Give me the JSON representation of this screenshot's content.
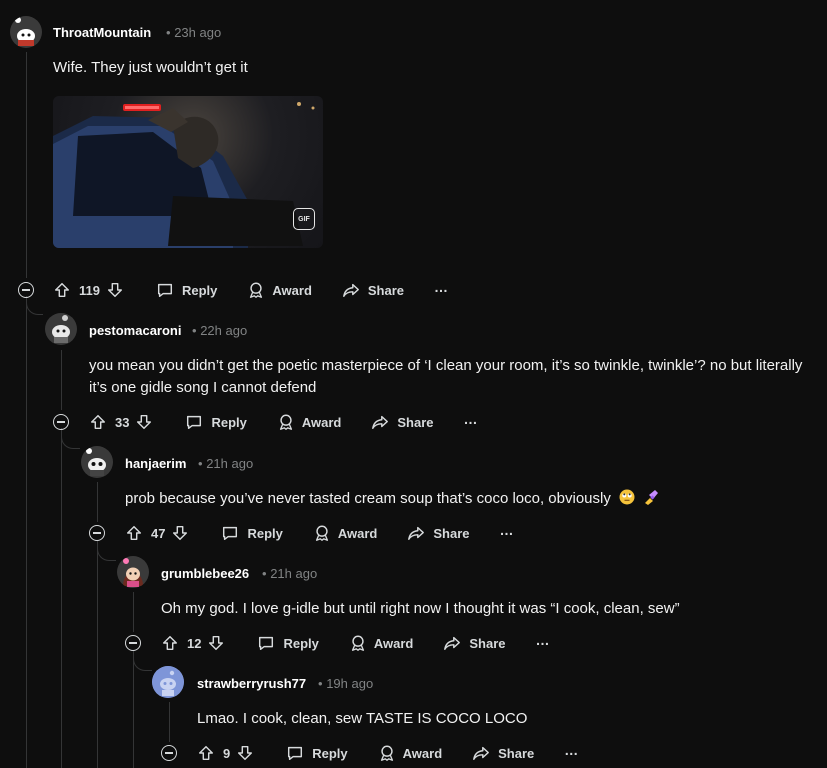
{
  "comments": [
    {
      "username": "ThroatMountain",
      "time": "23h ago",
      "body": "Wife. They just wouldn’t get it",
      "votes": "119",
      "reply_label": "Reply",
      "award_label": "Award",
      "share_label": "Share",
      "more_label": "…",
      "has_gif": true,
      "gif_badge": "GIF"
    },
    {
      "username": "pestomacaroni",
      "time": "22h ago",
      "body": "you mean you didn’t get the poetic masterpiece of ‘I clean your room, it’s so twinkle, twinkle’? no but literally it’s one gidle song I cannot defend",
      "votes": "33",
      "reply_label": "Reply",
      "award_label": "Award",
      "share_label": "Share",
      "more_label": "…"
    },
    {
      "username": "hanjaerim",
      "time": "21h ago",
      "body": "prob because you’ve never tasted cream soup that’s coco loco, obviously",
      "emojis": [
        "face-with-rolling-eyes",
        "nail-polish"
      ],
      "votes": "47",
      "reply_label": "Reply",
      "award_label": "Award",
      "share_label": "Share",
      "more_label": "…"
    },
    {
      "username": "grumblebee26",
      "time": "21h ago",
      "body": "Oh my god. I love g-idle but until right now I thought it was “I cook, clean, sew”",
      "votes": "12",
      "reply_label": "Reply",
      "award_label": "Award",
      "share_label": "Share",
      "more_label": "…"
    },
    {
      "username": "strawberryrush77",
      "time": "19h ago",
      "body": "Lmao. I cook, clean, sew TASTE IS COCO LOCO",
      "votes": "9",
      "reply_label": "Reply",
      "award_label": "Award",
      "share_label": "Share",
      "more_label": "…"
    }
  ],
  "meta_separator": "•",
  "colors": {
    "background": "#0e0e0e",
    "text": "#d7dadc",
    "muted": "#818384",
    "thread_line": "#343536"
  }
}
